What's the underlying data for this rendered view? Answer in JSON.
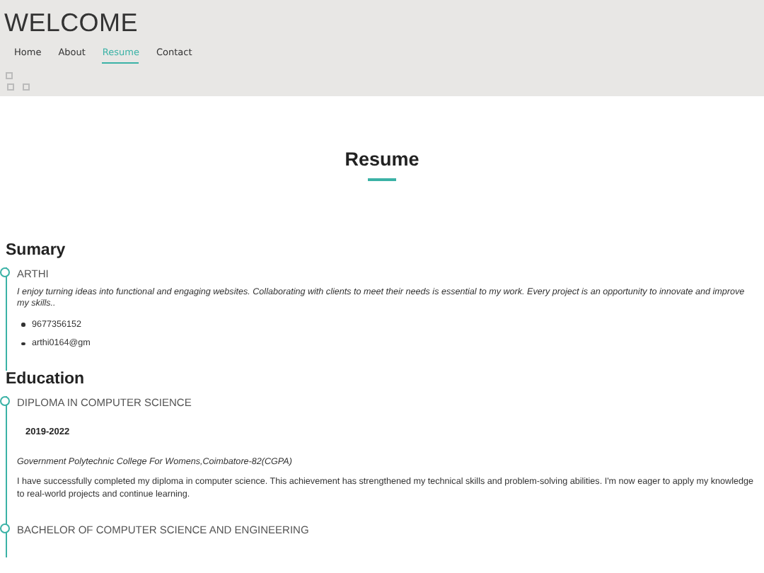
{
  "header": {
    "title": "WELCOME",
    "nav": [
      {
        "label": "Home",
        "selected": false
      },
      {
        "label": "About",
        "selected": false
      },
      {
        "label": "Resume",
        "selected": true
      },
      {
        "label": "Contact",
        "selected": false
      }
    ]
  },
  "page_title": "Resume",
  "sections": [
    {
      "heading": "Sumary",
      "items": [
        {
          "title": "ARTHI",
          "description": "I enjoy turning ideas into functional and engaging websites. Collaborating with clients to meet their needs is essential to my work. Every project is an opportunity to innovate and improve my skills..",
          "contacts": [
            "9677356152",
            "arthi0164@gm"
          ]
        }
      ]
    },
    {
      "heading": "Education",
      "items": [
        {
          "title": "DIPLOMA IN COMPUTER SCIENCE",
          "years": "2019-2022",
          "institution": "Government Polytechnic College For Womens,Coimbatore-82(CGPA)",
          "text": "I have successfully completed my diploma in computer science. This achievement has strengthened my technical skills and problem-solving abilities. I'm now eager to apply my knowledge to real-world projects and continue learning."
        },
        {
          "title": "BACHELOR OF COMPUTER SCIENCE AND ENGINEERING"
        }
      ]
    }
  ]
}
